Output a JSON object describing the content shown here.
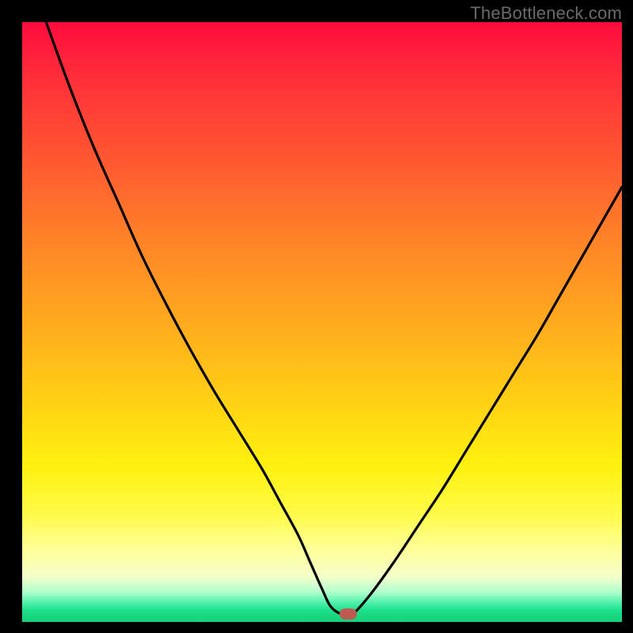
{
  "watermark": "TheBottleneck.com",
  "colors": {
    "frame": "#000000",
    "curve": "#000000",
    "marker": "#bf5a52",
    "gradient_top": "#ff0b3e",
    "gradient_bottom": "#14d279"
  },
  "chart_data": {
    "type": "line",
    "title": "",
    "xlabel": "",
    "ylabel": "",
    "xlim": [
      0,
      100
    ],
    "ylim": [
      0,
      100
    ],
    "grid": false,
    "legend": false,
    "series": [
      {
        "name": "curve",
        "x": [
          4,
          8,
          12,
          16,
          20,
          24,
          28,
          32,
          36,
          40,
          43,
          46,
          48,
          50,
          51.5,
          53.5,
          55,
          58,
          62,
          66,
          70,
          74,
          78,
          82,
          86,
          90,
          94,
          98,
          100
        ],
        "values": [
          100,
          89,
          79,
          70,
          61,
          53,
          45.5,
          38.5,
          32,
          25.5,
          20,
          14.5,
          10,
          5.5,
          2.5,
          1.2,
          1.2,
          4.5,
          10,
          16,
          22,
          28.5,
          35,
          41.5,
          48,
          55,
          62,
          69,
          72.5
        ]
      }
    ],
    "marker": {
      "x": 54.3,
      "y": 1.3
    },
    "note": "Axis values are percentage estimates read from the unlabeled plot; the curve forms an asymmetric V with its minimum near x≈54, and the small rounded marker sits at the trough."
  }
}
